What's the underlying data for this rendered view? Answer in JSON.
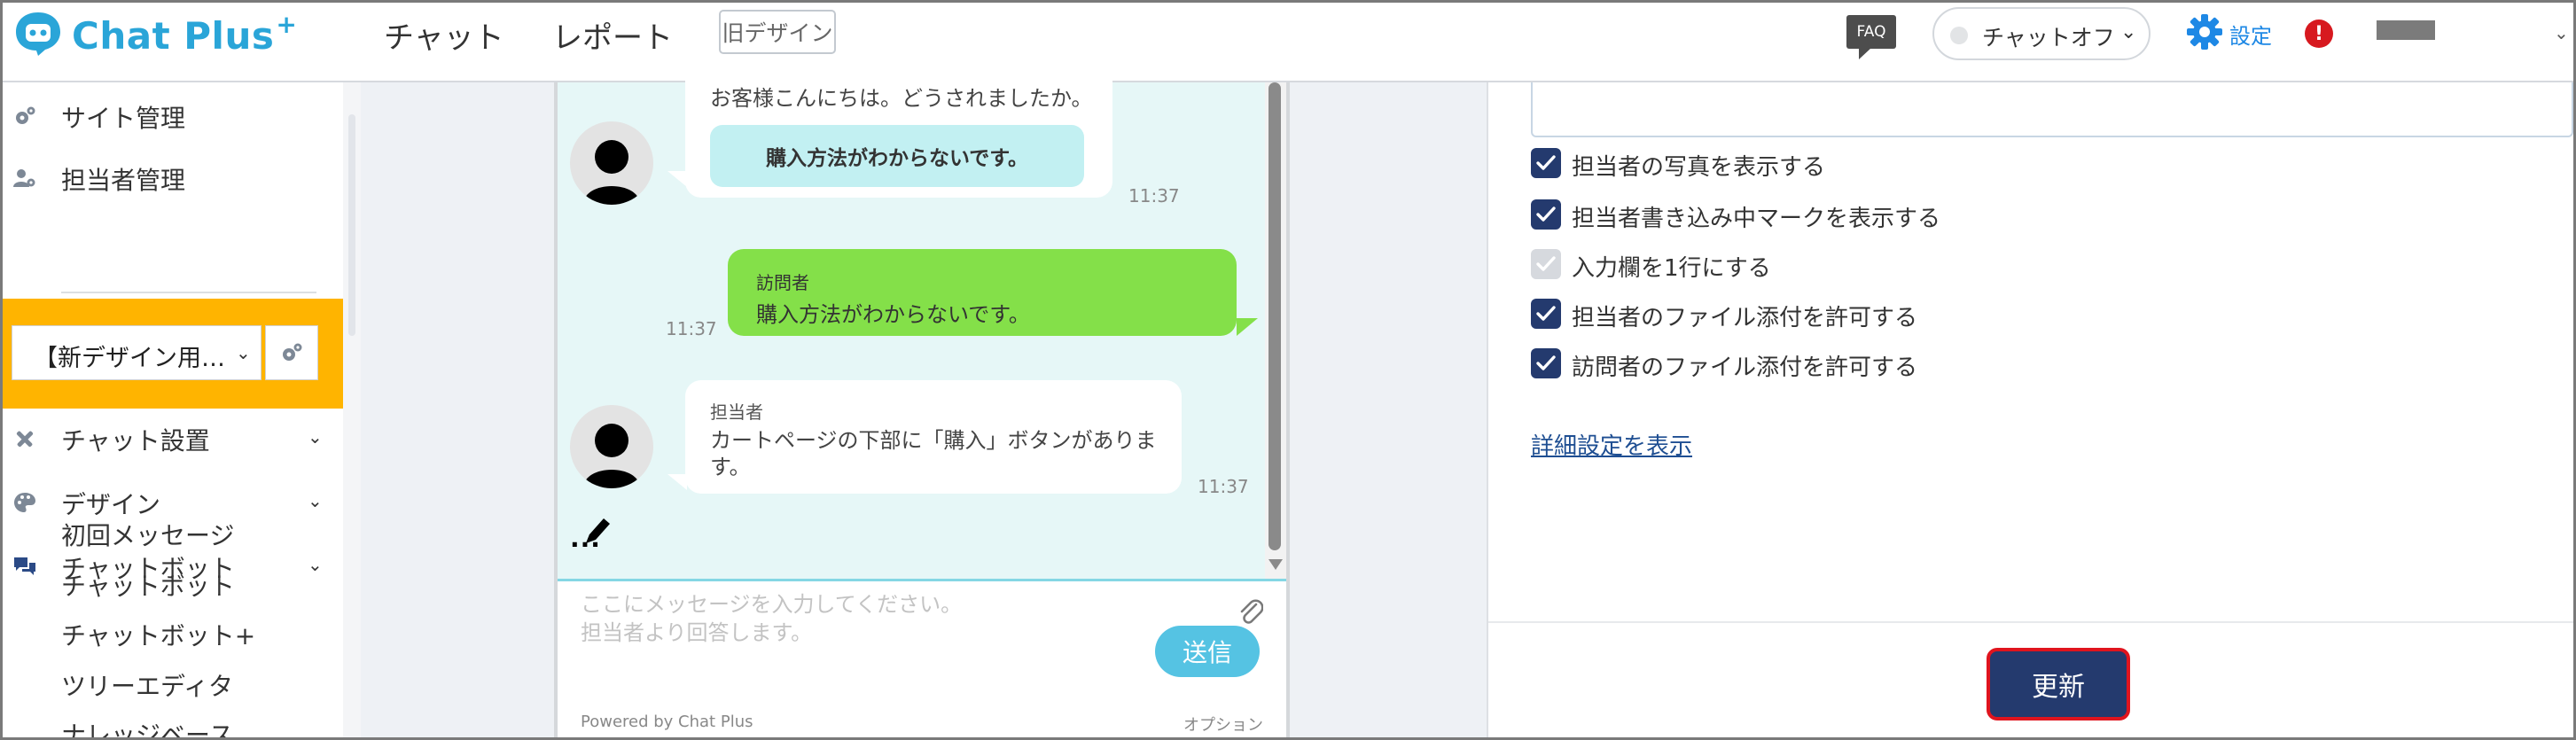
{
  "header": {
    "logo": "Chat Plus",
    "logo_plus": "+",
    "nav": [
      "チャット",
      "レポート"
    ],
    "old_design": "旧デザイン",
    "faq": "FAQ",
    "chat_status": "チャットオフ",
    "settings": "設定",
    "alert": "!"
  },
  "sidebar": {
    "site_admin": "サイト管理",
    "staff_admin": "担当者管理",
    "site_select": "【新デザイン用…",
    "items": [
      {
        "label": "チャット設置"
      },
      {
        "label": "デザイン"
      },
      {
        "label": "チャットボット"
      }
    ],
    "sub_items": [
      "初回メッセージ",
      "チャットボット",
      "チャットボット+",
      "ツリーエディタ",
      "ナレッジベース"
    ]
  },
  "chat_preview": {
    "greeting": "お客様こんにちは。どうされましたか。",
    "quick_reply": "購入方法がわからないです。",
    "time1": "11:37",
    "visitor_label": "訪問者",
    "visitor_message": "購入方法がわからないです。",
    "time2": "11:37",
    "agent_label": "担当者",
    "agent_message_line1": "カートページの下部に「購入」ボタンがありま",
    "agent_message_line2": "す。",
    "time3": "11:37",
    "typing_indicator": "...",
    "placeholder_line1": "ここにメッセージを入力してください。",
    "placeholder_line2": "担当者より回答します。",
    "send": "送信",
    "powered_by": "Powered by Chat Plus",
    "option": "オプション"
  },
  "settings_panel": {
    "checkboxes": [
      {
        "label": "担当者の写真を表示する",
        "checked": true
      },
      {
        "label": "担当者書き込み中マークを表示する",
        "checked": true
      },
      {
        "label": "入力欄を1行にする",
        "checked": true,
        "disabled": true
      },
      {
        "label": "担当者のファイル添付を許可する",
        "checked": true
      },
      {
        "label": "訪問者のファイル添付を許可する",
        "checked": true
      }
    ],
    "detail_link": "詳細設定を表示",
    "update": "更新"
  },
  "colors": {
    "brand": "#2aa5d8",
    "highlight": "#ffb400",
    "visitor_bubble": "#84e049",
    "chat_background": "#e6f7f7",
    "checkbox": "#243a6e",
    "update_button": "#243a6e",
    "update_border": "#e0141e",
    "alert": "#d7191f"
  }
}
